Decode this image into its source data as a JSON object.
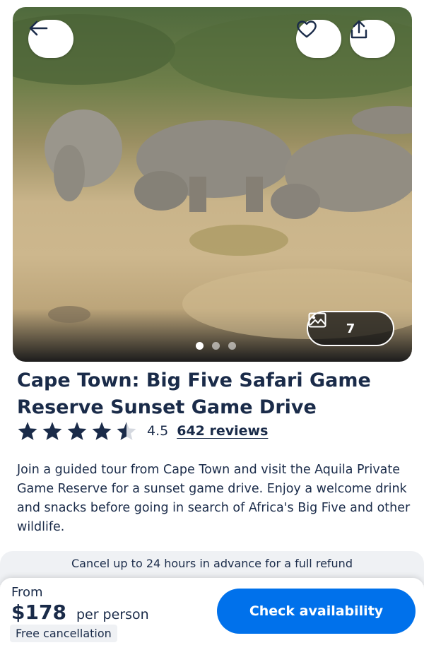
{
  "hero": {
    "photo_count": "7",
    "carousel_dots": 3,
    "active_dot": 0
  },
  "header_actions": {
    "back_icon": "arrow-left-icon",
    "favorite_icon": "heart-icon",
    "share_icon": "share-icon"
  },
  "activity": {
    "title": "Cape Town: Big Five Safari Game Reserve Sunset Game Drive",
    "rating": "4.5",
    "rating_value": 4.5,
    "reviews_label": "642 reviews",
    "description": "Join a guided tour from Cape Town and visit the Aquila Private Game Reserve for a sunset game drive. Enjoy a welcome drink and snacks before going in search of Africa's Big Five and other wildlife."
  },
  "cancellation_banner": "Cancel up to 24 hours in advance for a full refund",
  "booking": {
    "from_label": "From",
    "price": "$178",
    "per_label": "per person",
    "free_cancellation": "Free cancellation",
    "cta_label": "Check availability"
  },
  "colors": {
    "primary_text": "#1a2b49",
    "cta": "#0071eb",
    "badge_bg": "#eff1f4"
  }
}
